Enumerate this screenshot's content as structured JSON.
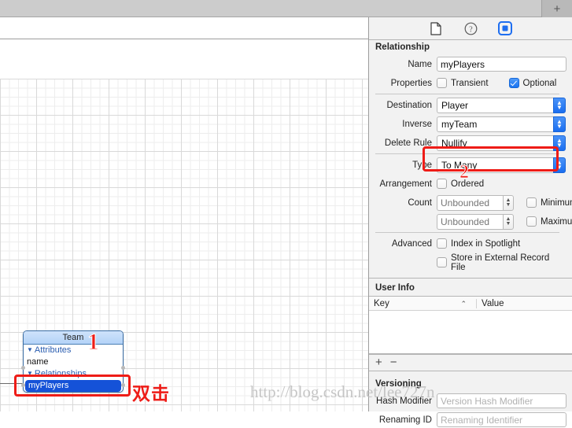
{
  "window": {
    "new_tab_button": "+"
  },
  "inspector": {
    "toolbar": {
      "icons": [
        {
          "name": "file-inspector-icon",
          "label": "File inspector",
          "active": false
        },
        {
          "name": "help-inspector-icon",
          "label": "Quick help inspector",
          "active": false
        },
        {
          "name": "data-model-inspector-icon",
          "label": "Data model inspector",
          "active": true
        }
      ]
    },
    "relationship": {
      "section_title": "Relationship",
      "name_label": "Name",
      "name_value": "myPlayers",
      "properties_label": "Properties",
      "transient_label": "Transient",
      "transient_checked": false,
      "optional_label": "Optional",
      "optional_checked": true,
      "destination_label": "Destination",
      "destination_value": "Player",
      "inverse_label": "Inverse",
      "inverse_value": "myTeam",
      "delete_rule_label": "Delete Rule",
      "delete_rule_value": "Nullify",
      "type_label": "Type",
      "type_value": "To Many",
      "arrangement_label": "Arrangement",
      "ordered_label": "Ordered",
      "ordered_checked": false,
      "count_label": "Count",
      "count_min_placeholder": "Unbounded",
      "count_max_placeholder": "Unbounded",
      "minimum_label": "Minimum",
      "minimum_checked": false,
      "maximum_label": "Maximum",
      "maximum_checked": false,
      "advanced_label": "Advanced",
      "index_spotlight_label": "Index in Spotlight",
      "index_spotlight_checked": false,
      "store_external_label": "Store in External Record File",
      "store_external_checked": false
    },
    "user_info": {
      "section_title": "User Info",
      "col_key": "Key",
      "col_value": "Value",
      "sort_indicator": "⌃",
      "add_button": "+",
      "remove_button": "−"
    },
    "versioning": {
      "section_title": "Versioning",
      "hash_modifier_label": "Hash Modifier",
      "hash_modifier_placeholder": "Version Hash Modifier",
      "hash_modifier_value": "",
      "renaming_id_label": "Renaming ID",
      "renaming_id_placeholder": "Renaming Identifier",
      "renaming_id_value": ""
    }
  },
  "canvas": {
    "entity": {
      "title": "Team",
      "attributes_group": "Attributes",
      "attributes": [
        "name"
      ],
      "relationships_group": "Relationships",
      "relationships": [
        "myPlayers"
      ],
      "selected_relationship": "myPlayers",
      "disclosure_glyph": "▼"
    }
  },
  "annotations": {
    "marker_1": "1",
    "marker_2": "2",
    "hint_text": "双击",
    "highlight_color": "#ee1c17"
  },
  "watermark": {
    "text": "http://blog.csdn.net/lee727n"
  }
}
